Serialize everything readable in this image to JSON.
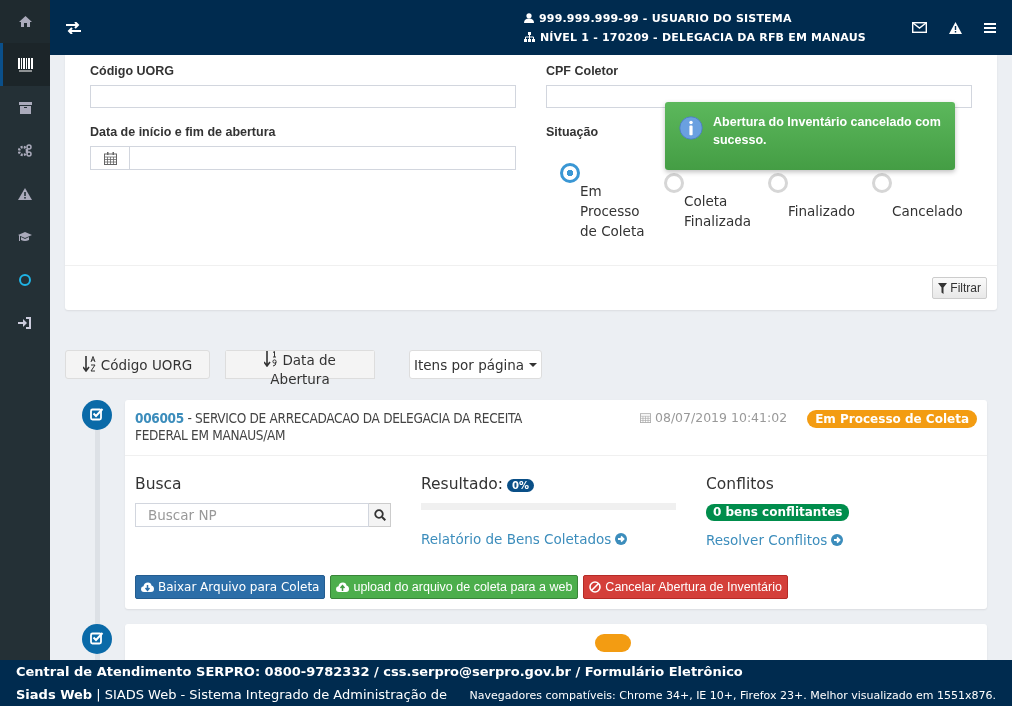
{
  "sidebar": {
    "items": [
      {
        "kind": "home",
        "selected": false
      },
      {
        "kind": "barcode",
        "selected": true
      },
      {
        "kind": "archive",
        "selected": false
      },
      {
        "kind": "gears",
        "selected": false
      },
      {
        "kind": "warning",
        "selected": false
      },
      {
        "kind": "graduation",
        "selected": false
      },
      {
        "kind": "circle",
        "selected": false
      },
      {
        "kind": "sign-in",
        "selected": false
      }
    ]
  },
  "topbar": {
    "user": "999.999.999-99 - USUARIO DO SISTEMA",
    "unit": "NÍVEL 1 - 170209 - DELEGACIA DA RFB EM MANAUS"
  },
  "filter": {
    "fields": [
      {
        "label": "Código UORG",
        "kind": "text"
      },
      {
        "label": "CPF Coletor",
        "kind": "text"
      },
      {
        "label": "Data de início e fim de abertura",
        "kind": "date"
      }
    ],
    "situacao": {
      "label": "Situação",
      "options": [
        {
          "label": "Em Processo de Coleta",
          "selected": true
        },
        {
          "label": "Coleta Finalizada",
          "selected": false
        },
        {
          "label": "Finalizado",
          "selected": false
        },
        {
          "label": "Cancelado",
          "selected": false
        }
      ]
    },
    "button": "Filtrar"
  },
  "toast": {
    "message": "Abertura do Inventário cancelado com sucesso."
  },
  "toolbar": {
    "sort_buttons": [
      {
        "label": "Código UORG",
        "kind": "alpha"
      },
      {
        "label": "Data de Abertura",
        "kind": "numeric"
      }
    ],
    "page_size": "Itens por página"
  },
  "cards": [
    {
      "code": "006005",
      "title": " - SERVICO DE ARRECADACAO DA DELEGACIA DA RECEITA FEDERAL EM MANAUS/AM",
      "date": "08/07/2019 10:41:02",
      "status": {
        "text": "Em Processo de Coleta",
        "kind": "processing"
      },
      "busca": {
        "label": "Busca",
        "placeholder": "Buscar NP"
      },
      "resultado": {
        "label": "Resultado:",
        "badge": "0%",
        "level": 0,
        "link": "Relatório de Bens Coletados"
      },
      "conflitos": {
        "label": "Conflitos",
        "badge": "0 bens conflitantes",
        "link": "Resolver Conflitos"
      },
      "actions": [
        {
          "label": "Baixar Arquivo para Coleta",
          "kind": "download"
        },
        {
          "label": "upload do arquivo de coleta para a web",
          "kind": "upload"
        },
        {
          "label": "Cancelar Abertura de Inventário",
          "kind": "cancel"
        }
      ]
    },
    {
      "status": {
        "kind": "processing"
      }
    }
  ],
  "footer": {
    "contact": "Central de Atendimento SERPRO: 0800-9782332 / css.serpro@serpro.gov.br / Formulário Eletrônico",
    "app_name": "Siads Web",
    "app_desc": "| SIADS Web - Sistema Integrado de Administração de",
    "browsers": "Navegadores compatíveis: Chrome 34+, IE 10+, Firefox 23+. Melhor visualizado em 1551x876."
  }
}
